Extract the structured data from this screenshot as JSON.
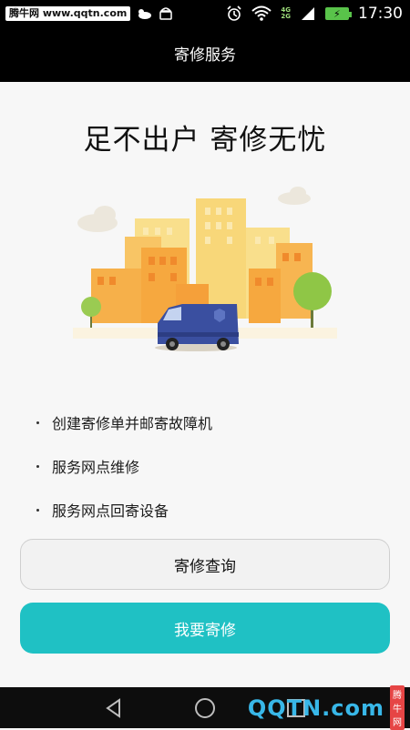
{
  "status_bar": {
    "watermark": "腾牛网 www.qqtn.com",
    "network_top": "4G",
    "network_bottom": "2G",
    "time": "17:30"
  },
  "header": {
    "title": "寄修服务"
  },
  "hero": {
    "title": "足不出户 寄修无忧"
  },
  "features": [
    {
      "label": "创建寄修单并邮寄故障机"
    },
    {
      "label": "服务网点维修"
    },
    {
      "label": "服务网点回寄设备"
    }
  ],
  "buttons": {
    "query_label": "寄修查询",
    "repair_label": "我要寄修"
  },
  "watermark_logo": {
    "text": "QQTN.com",
    "badge": "腾牛网"
  },
  "colors": {
    "primary": "#1fc1c4",
    "header_bg": "#000000",
    "content_bg": "#f7f7f7"
  },
  "icons": {
    "nav_back": "triangle-back-icon",
    "nav_home": "circle-home-icon",
    "nav_recent": "square-recent-icon"
  }
}
